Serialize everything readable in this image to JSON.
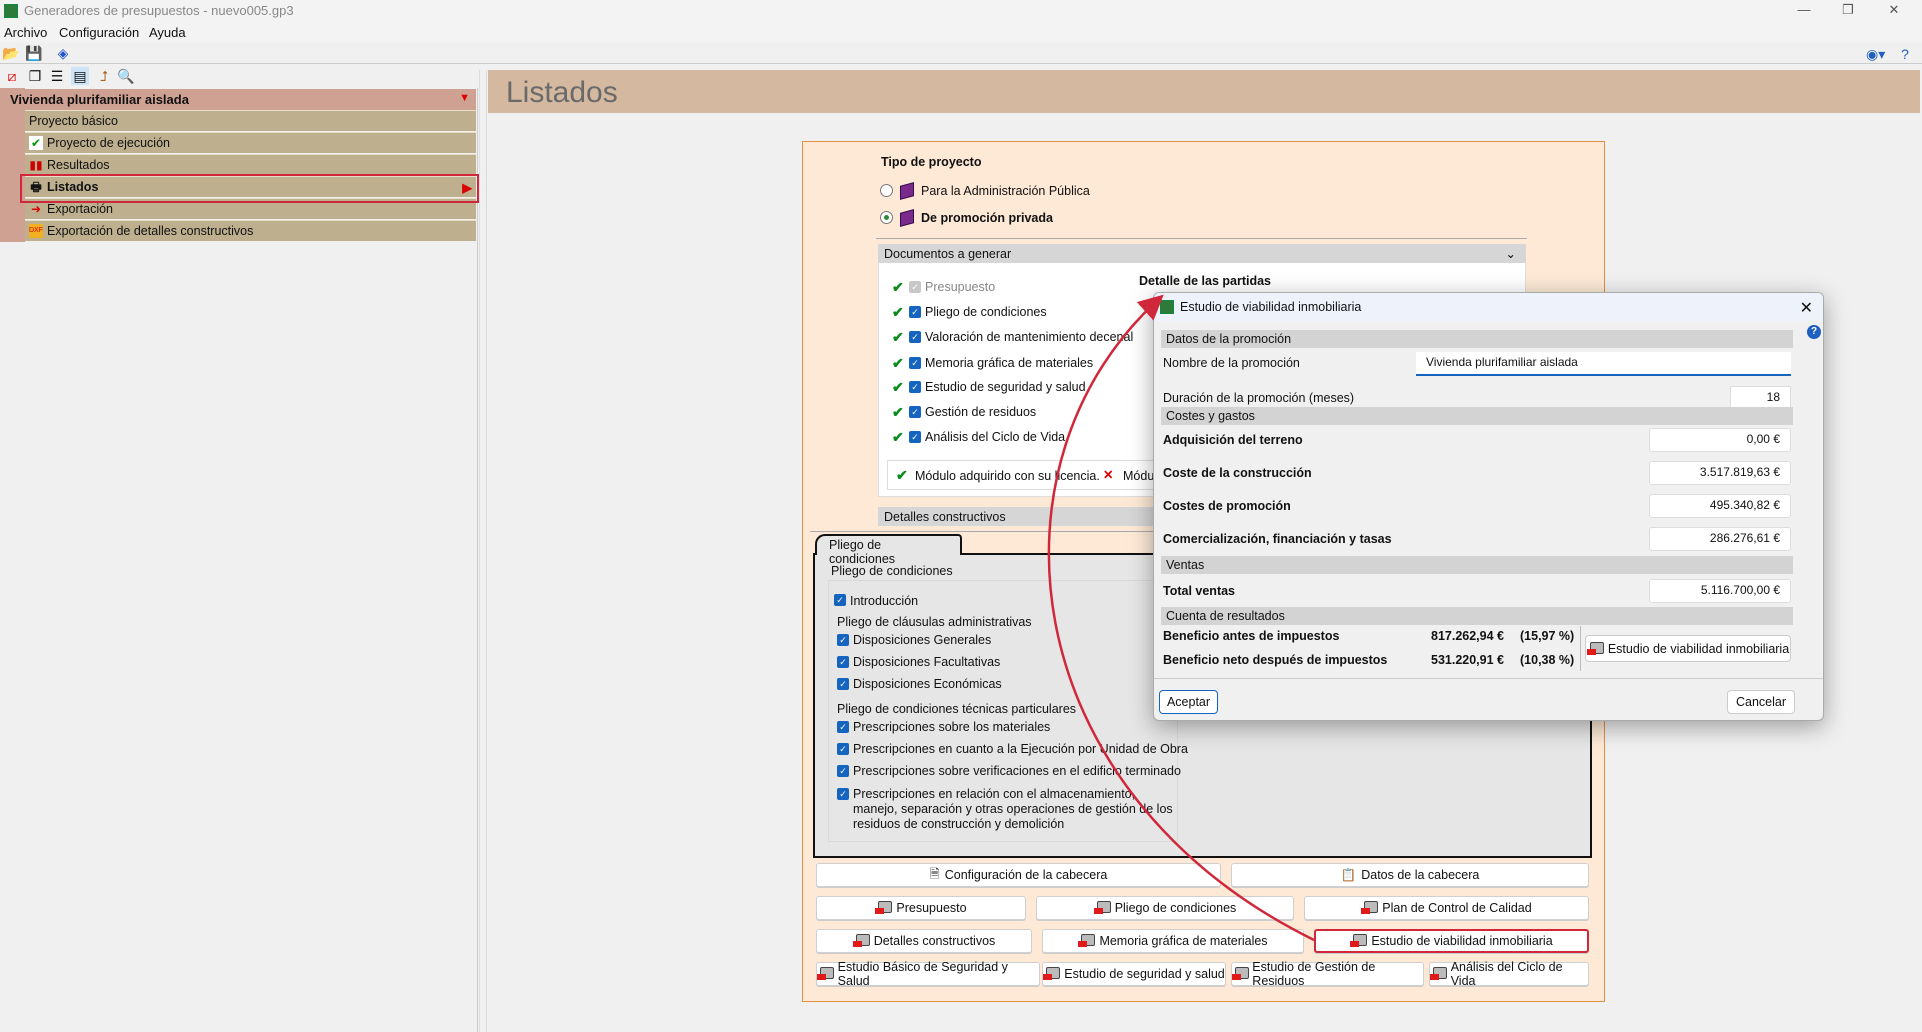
{
  "window": {
    "title": "Generadores de presupuestos - nuevo005.gp3"
  },
  "menu": [
    "Archivo",
    "Configuración",
    "Ayuda"
  ],
  "tree": {
    "root": "Vivienda plurifamiliar aislada",
    "items": [
      {
        "label": "Proyecto básico",
        "icon": ""
      },
      {
        "label": "Proyecto de ejecución",
        "icon": "check-icon"
      },
      {
        "label": "Resultados",
        "icon": "bar-chart-icon"
      },
      {
        "label": "Listados",
        "icon": "printer-icon",
        "selected": true
      },
      {
        "label": "Exportación",
        "icon": "export-icon"
      },
      {
        "label": "Exportación de detalles constructivos",
        "icon": "dxf-export-icon"
      }
    ]
  },
  "page": {
    "title": "Listados"
  },
  "tipo": {
    "title": "Tipo de proyecto",
    "options": [
      "Para la Administración Pública",
      "De promoción privada"
    ],
    "selected": 1
  },
  "documentos": {
    "header": "Documentos a generar",
    "items": [
      {
        "label": "Presupuesto",
        "checked": true,
        "disabled": true
      },
      {
        "label": "Pliego de condiciones",
        "checked": true
      },
      {
        "label": "Valoración de mantenimiento decenal",
        "checked": true
      },
      {
        "label": "Memoria gráfica de materiales",
        "checked": true
      },
      {
        "label": "Estudio de seguridad y salud",
        "checked": true
      },
      {
        "label": "Gestión de residuos",
        "checked": true
      },
      {
        "label": "Análisis del Ciclo de Vida",
        "checked": true
      }
    ],
    "detalle": "Detalle de las partidas",
    "legend_ok": "Módulo adquirido con su licencia.",
    "legend_no": "Módu"
  },
  "detalles_header": "Detalles constructivos",
  "pliego": {
    "tab": "Pliego de condiciones",
    "title": "Pliego de condiciones",
    "intro": "Introducción",
    "admin_title": "Pliego de cláusulas administrativas",
    "admin": [
      "Disposiciones Generales",
      "Disposiciones Facultativas",
      "Disposiciones Económicas"
    ],
    "tec_title": "Pliego de condiciones técnicas particulares",
    "tec": [
      "Prescripciones sobre los materiales",
      "Prescripciones en cuanto a la Ejecución por Unidad de Obra",
      "Prescripciones sobre verificaciones en el edificio terminado",
      "Prescripciones en relación con el almacenamiento, manejo, separación y otras operaciones de gestión de los residuos de construcción y demolición"
    ]
  },
  "buttons": {
    "config_cabecera": "Configuración de la cabecera",
    "datos_cabecera": "Datos de la cabecera",
    "presupuesto": "Presupuesto",
    "pliego": "Pliego de condiciones",
    "plan_calidad": "Plan de Control de Calidad",
    "detalles": "Detalles constructivos",
    "memoria": "Memoria gráfica de materiales",
    "viabilidad": "Estudio de viabilidad inmobiliaria",
    "ebss": "Estudio Básico de Seguridad y Salud",
    "ess": "Estudio de seguridad y salud",
    "residuos": "Estudio de Gestión de Residuos",
    "acv": "Análisis del Ciclo de Vida"
  },
  "dialog": {
    "title": "Estudio de viabilidad inmobiliaria",
    "sec_datos": "Datos de la promoción",
    "nombre_label": "Nombre de la promoción",
    "nombre_value": "Vivienda plurifamiliar aislada",
    "duracion_label": "Duración de la promoción (meses)",
    "duracion_value": "18",
    "sec_costes": "Costes y gastos",
    "terreno_label": "Adquisición del terreno",
    "terreno_value": "0,00 €",
    "construccion_label": "Coste de la construcción",
    "construccion_value": "3.517.819,63 €",
    "promocion_label": "Costes de promoción",
    "promocion_value": "495.340,82 €",
    "comerc_label": "Comercialización, financiación y tasas",
    "comerc_value": "286.276,61 €",
    "sec_ventas": "Ventas",
    "ventas_label": "Total ventas",
    "ventas_value": "5.116.700,00 €",
    "sec_cuenta": "Cuenta de resultados",
    "bai_label": "Beneficio antes de impuestos",
    "bai_value": "817.262,94 €",
    "bai_pct": "(15,97 %)",
    "bdi_label": "Beneficio neto después de impuestos",
    "bdi_value": "531.220,91 €",
    "bdi_pct": "(10,38 %)",
    "report_btn": "Estudio de viabilidad inmobiliaria",
    "ok": "Aceptar",
    "cancel": "Cancelar"
  },
  "colors": {
    "highlight": "#d0283a",
    "accent": "#1565c0",
    "panel": "#fde9d6",
    "tree_head": "#cfa193",
    "tree_item": "#beaf8f"
  }
}
